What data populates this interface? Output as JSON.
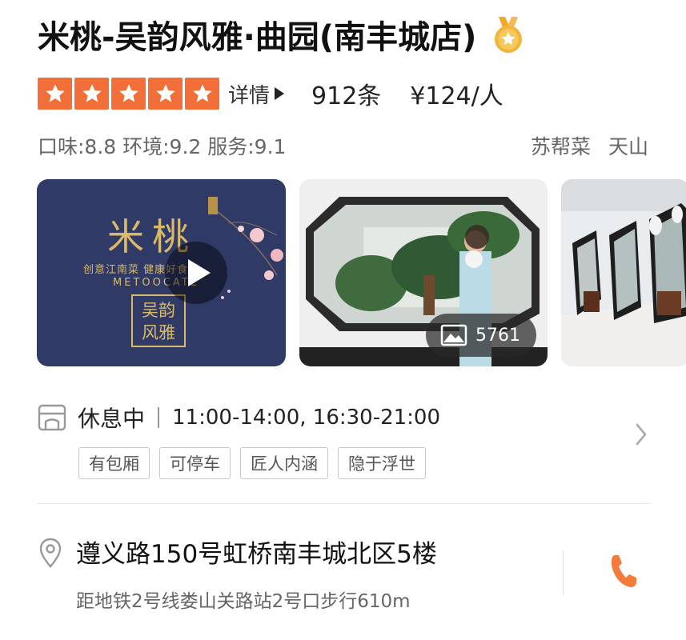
{
  "shop": {
    "name": "米桃-吴韵风雅·曲园(南丰城店)",
    "star_rating": 5,
    "detail_label": "详情",
    "review_count": "912条",
    "price_per_person": "¥124/人",
    "scores": "口味:8.8 环境:9.2 服务:9.1",
    "category": "苏帮菜",
    "district": "天山"
  },
  "gallery": {
    "logo_main": "米桃",
    "logo_sub": "创意江南菜 健康好食材",
    "logo_en": "METOOCATE",
    "logo_stamp_line1": "吴韵",
    "logo_stamp_line2": "风雅",
    "photo_count": "5761"
  },
  "hours": {
    "status": "休息中",
    "time": "11:00-14:00, 16:30-21:00"
  },
  "features": [
    "有包厢",
    "可停车",
    "匠人内涵",
    "隐于浮世"
  ],
  "location": {
    "address": "遵义路150号虹桥南丰城北区5楼",
    "distance": "距地铁2号线娄山关路站2号口步行610m"
  },
  "colors": {
    "star_orange": "#f26f3a",
    "medal_gold": "#f2b43a",
    "phone_orange": "#f57b3d",
    "video_bg": "#2f3a66"
  },
  "icons": [
    "medal-icon",
    "star-icon",
    "play-icon",
    "image-icon",
    "storefront-icon",
    "chevron-right-icon",
    "location-pin-icon",
    "phone-icon"
  ]
}
